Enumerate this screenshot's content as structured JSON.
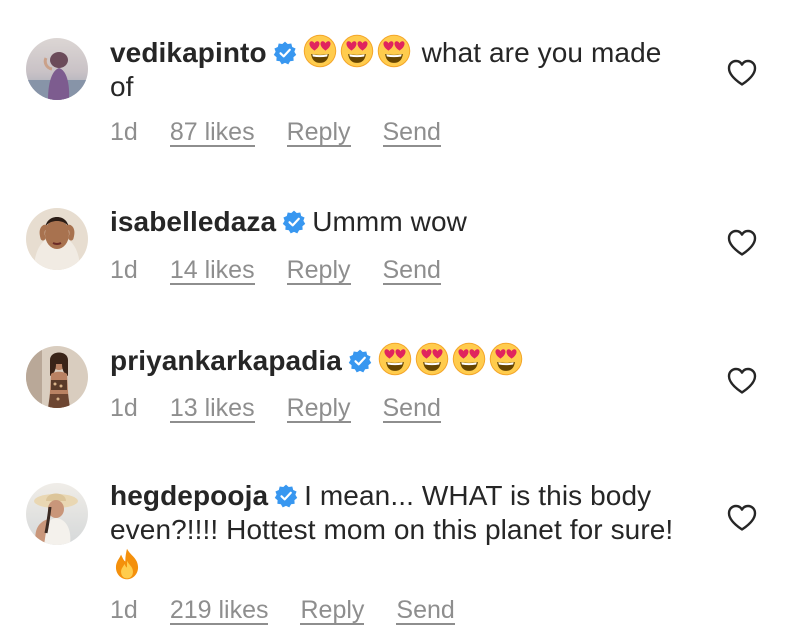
{
  "comments": [
    {
      "username": "vedikapinto",
      "text": "what are you made of",
      "emojis_before_text": [
        "heart-eyes",
        "heart-eyes",
        "heart-eyes"
      ],
      "time": "1d",
      "likes": "87 likes",
      "reply": "Reply",
      "send": "Send"
    },
    {
      "username": "isabelledaza",
      "text": "Ummm wow",
      "time": "1d",
      "likes": "14 likes",
      "reply": "Reply",
      "send": "Send"
    },
    {
      "username": "priyankarkapadia",
      "text": "",
      "emojis_before_text": [
        "heart-eyes",
        "heart-eyes",
        "heart-eyes",
        "heart-eyes"
      ],
      "time": "1d",
      "likes": "13 likes",
      "reply": "Reply",
      "send": "Send"
    },
    {
      "username": "hegdepooja",
      "text": "I mean... WHAT is this body even?!!!! Hottest mom on this planet for sure!",
      "emojis_after_text": [
        "fire"
      ],
      "time": "1d",
      "likes": "219 likes",
      "reply": "Reply",
      "send": "Send"
    }
  ],
  "colors": {
    "text": "#262626",
    "secondary_text": "#8e8e8e",
    "verified_badge": "#3897f0",
    "background": "#ffffff"
  },
  "icons": [
    "verified-badge-icon",
    "heart-outline-icon",
    "heart-eyes-emoji-icon",
    "fire-emoji-icon"
  ]
}
